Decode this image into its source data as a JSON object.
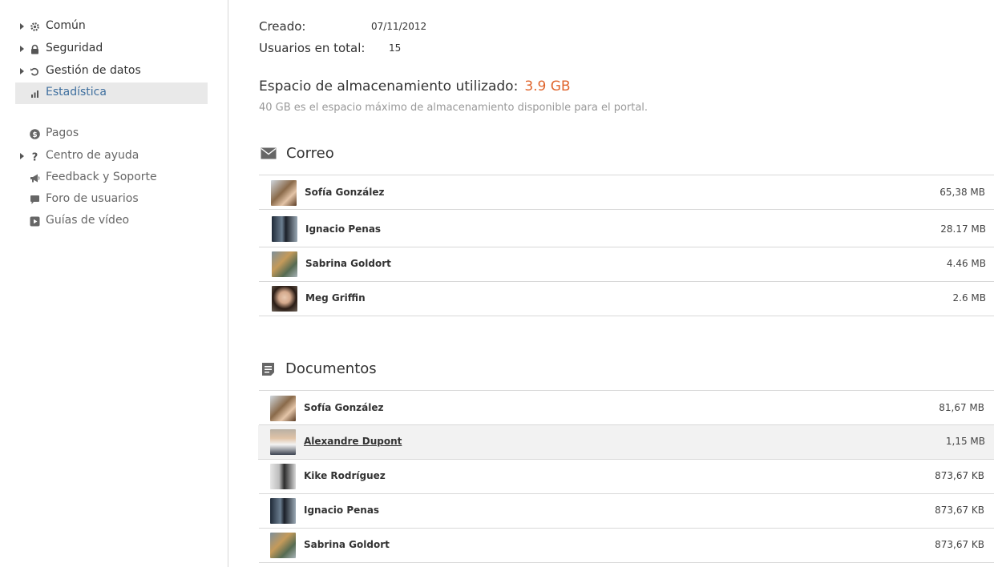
{
  "sidebar": {
    "items": [
      {
        "label": "Común",
        "icon": "gear-icon"
      },
      {
        "label": "Seguridad",
        "icon": "lock-icon"
      },
      {
        "label": "Gestión de datos",
        "icon": "restore-icon"
      },
      {
        "label": "Estadística",
        "icon": "bar-chart-icon"
      },
      {
        "label": "Pagos",
        "icon": "dollar-icon"
      },
      {
        "label": "Centro de ayuda",
        "icon": "question-icon"
      },
      {
        "label": "Feedback y Soporte",
        "icon": "megaphone-icon"
      },
      {
        "label": "Foro de usuarios",
        "icon": "speech-bubble-icon"
      },
      {
        "label": "Guías de vídeo",
        "icon": "play-icon"
      }
    ]
  },
  "info": {
    "created_label": "Creado:",
    "created_value": "07/11/2012",
    "users_label": "Usuarios en total:",
    "users_value": "15"
  },
  "storage": {
    "title": "Espacio de almacenamiento utilizado:",
    "value": "3.9 GB",
    "note": "40 GB es el espacio máximo de almacenamiento disponible para el portal."
  },
  "mail": {
    "title": "Correo",
    "rows": [
      {
        "name": "Sofía González",
        "size": "65,38 MB"
      },
      {
        "name": "Ignacio Penas",
        "size": "28.17 MB"
      },
      {
        "name": "Sabrina Goldort",
        "size": "4.46 MB"
      },
      {
        "name": "Meg Griffin",
        "size": "2.6 MB"
      }
    ]
  },
  "documents": {
    "title": "Documentos",
    "rows": [
      {
        "name": "Sofía González",
        "size": "81,67 MB"
      },
      {
        "name": "Alexandre Dupont",
        "size": "1,15 MB"
      },
      {
        "name": "Kike Rodríguez",
        "size": "873,67 KB"
      },
      {
        "name": "Ignacio Penas",
        "size": "873,67 KB"
      },
      {
        "name": "Sabrina Goldort",
        "size": "873,67 KB"
      }
    ]
  },
  "colors": {
    "accent": "#e0662e",
    "active_link": "#3d6e9e",
    "active_bg": "#e9e9e9"
  }
}
